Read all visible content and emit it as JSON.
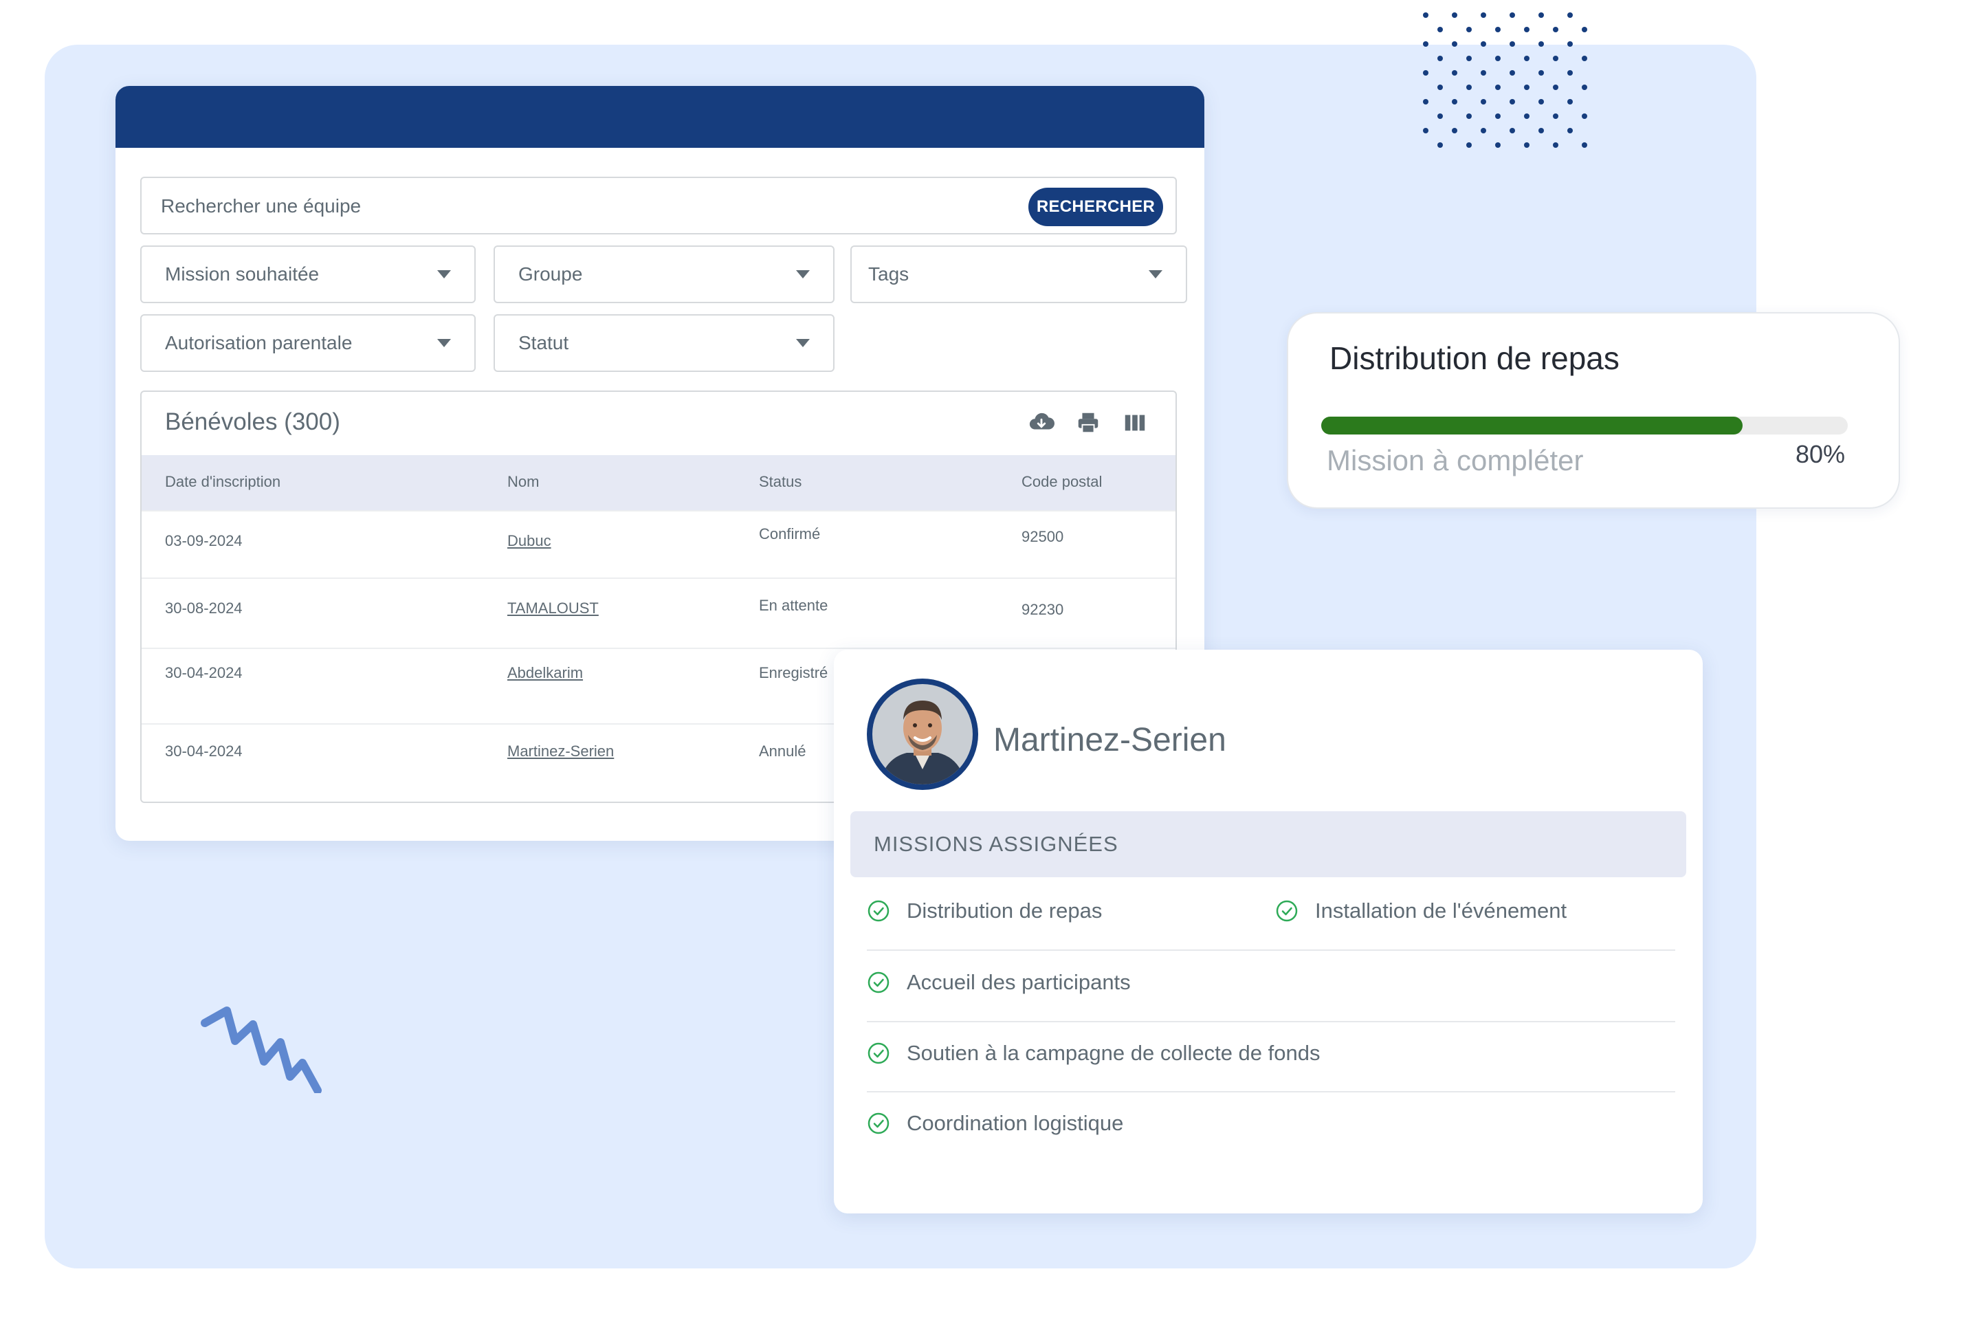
{
  "search": {
    "placeholder": "Rechercher une équipe",
    "button_label": "RECHERCHER"
  },
  "filters": [
    {
      "label": "Mission souhaitée"
    },
    {
      "label": "Groupe"
    },
    {
      "label": "Tags"
    },
    {
      "label": "Autorisation parentale"
    },
    {
      "label": "Statut"
    }
  ],
  "table": {
    "title": "Bénévoles (300)",
    "tools": [
      "cloud-download-icon",
      "print-icon",
      "columns-icon"
    ],
    "columns": [
      "Date d'inscription",
      "Nom",
      "Status",
      "Code postal"
    ],
    "rows": [
      {
        "date": "03-09-2024",
        "name": "Dubuc",
        "status": "Confirmé",
        "postal": "92500"
      },
      {
        "date": "30-08-2024",
        "name": "TAMALOUST",
        "status": "En attente",
        "postal": "92230"
      },
      {
        "date": "30-04-2024",
        "name": "Abdelkarim",
        "status": "Enregistré",
        "postal": ""
      },
      {
        "date": "30-04-2024",
        "name": "Martinez-Serien",
        "status": "Annulé",
        "postal": ""
      }
    ]
  },
  "progress": {
    "title": "Distribution de repas",
    "label": "Mission à compléter",
    "percent_text": "80%",
    "value": 0.8,
    "color": "#2b7a1c"
  },
  "profile": {
    "name": "Martinez-Serien",
    "missions_header": "MISSIONS ASSIGNÉES",
    "missions": [
      "Distribution de repas",
      "Installation de l'événement",
      "Accueil des participants",
      "Soutien à la campagne de collecte de fonds",
      "Coordination logistique"
    ]
  },
  "colors": {
    "primary": "#163d7e",
    "panel_bg": "#e1ecfe",
    "check": "#2eaa57",
    "accent_squiggle": "#5f88d0"
  }
}
